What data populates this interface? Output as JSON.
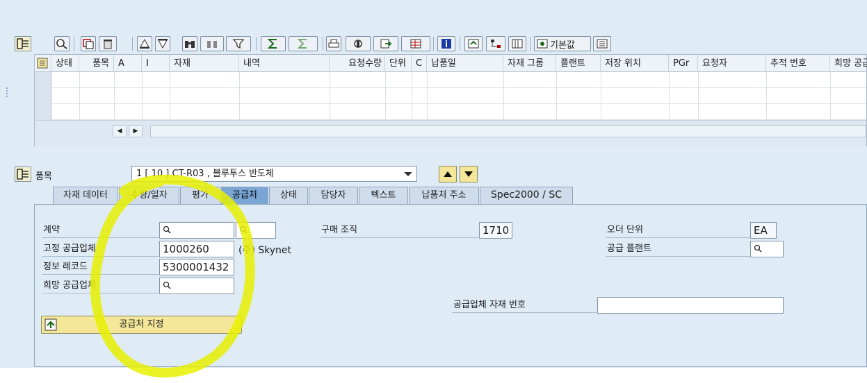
{
  "toolbar": {
    "defaults_label": "기본값"
  },
  "grid": {
    "columns": [
      "상태",
      "품목",
      "A",
      "I",
      "자재",
      "내역",
      "요청수량",
      "단위",
      "C",
      "납품일",
      "자재 그룹",
      "플랜트",
      "저장 위치",
      "PGr",
      "요청자",
      "추적 번호",
      "희망 공급"
    ],
    "rows": [
      [],
      [],
      []
    ]
  },
  "item_section": {
    "label": "품목",
    "selected_item": "1 [ 10 ] CT-R03 , 블루투스 반도체"
  },
  "tabs": [
    {
      "label": "자재 데이터",
      "active": false
    },
    {
      "label": "수량/일자",
      "active": false
    },
    {
      "label": "평가",
      "active": false
    },
    {
      "label": "공급처",
      "active": true
    },
    {
      "label": "상태",
      "active": false
    },
    {
      "label": "담당자",
      "active": false
    },
    {
      "label": "텍스트",
      "active": false
    },
    {
      "label": "납품처 주소",
      "active": false
    },
    {
      "label": "Spec2000 / SC",
      "active": false
    }
  ],
  "source": {
    "contract_label": "계약",
    "contract_value": "",
    "contract_item_value": "",
    "fixed_vendor_label": "고정 공급업체",
    "fixed_vendor_value": "1000260",
    "fixed_vendor_name": "(주) Skynet",
    "info_record_label": "정보 레코드",
    "info_record_value": "5300001432",
    "desired_vendor_label": "희망 공급업체",
    "desired_vendor_value": "",
    "purch_org_label": "구매 조직",
    "purch_org_value": "1710",
    "order_unit_label": "오더 단위",
    "order_unit_value": "EA",
    "supplying_plant_label": "공급 플랜트",
    "supplying_plant_value": "",
    "vendor_material_label": "공급업체 자재 번호",
    "vendor_material_value": "",
    "assign_button_label": "공급처 지정"
  },
  "colors": {
    "background": "#dfebf5",
    "active_tab": "#7aa6d6",
    "button_yellow": "#f5e79a",
    "annotation_highlight": "#e8f000"
  },
  "icons": [
    "grid-settings-icon",
    "search-icon",
    "details-icon",
    "delete-icon",
    "print-icon",
    "filter-icon",
    "sum-icon",
    "export-icon",
    "info-icon",
    "defaults-icon",
    "scroll-up-icon",
    "scroll-down-icon",
    "assign-source-icon"
  ]
}
